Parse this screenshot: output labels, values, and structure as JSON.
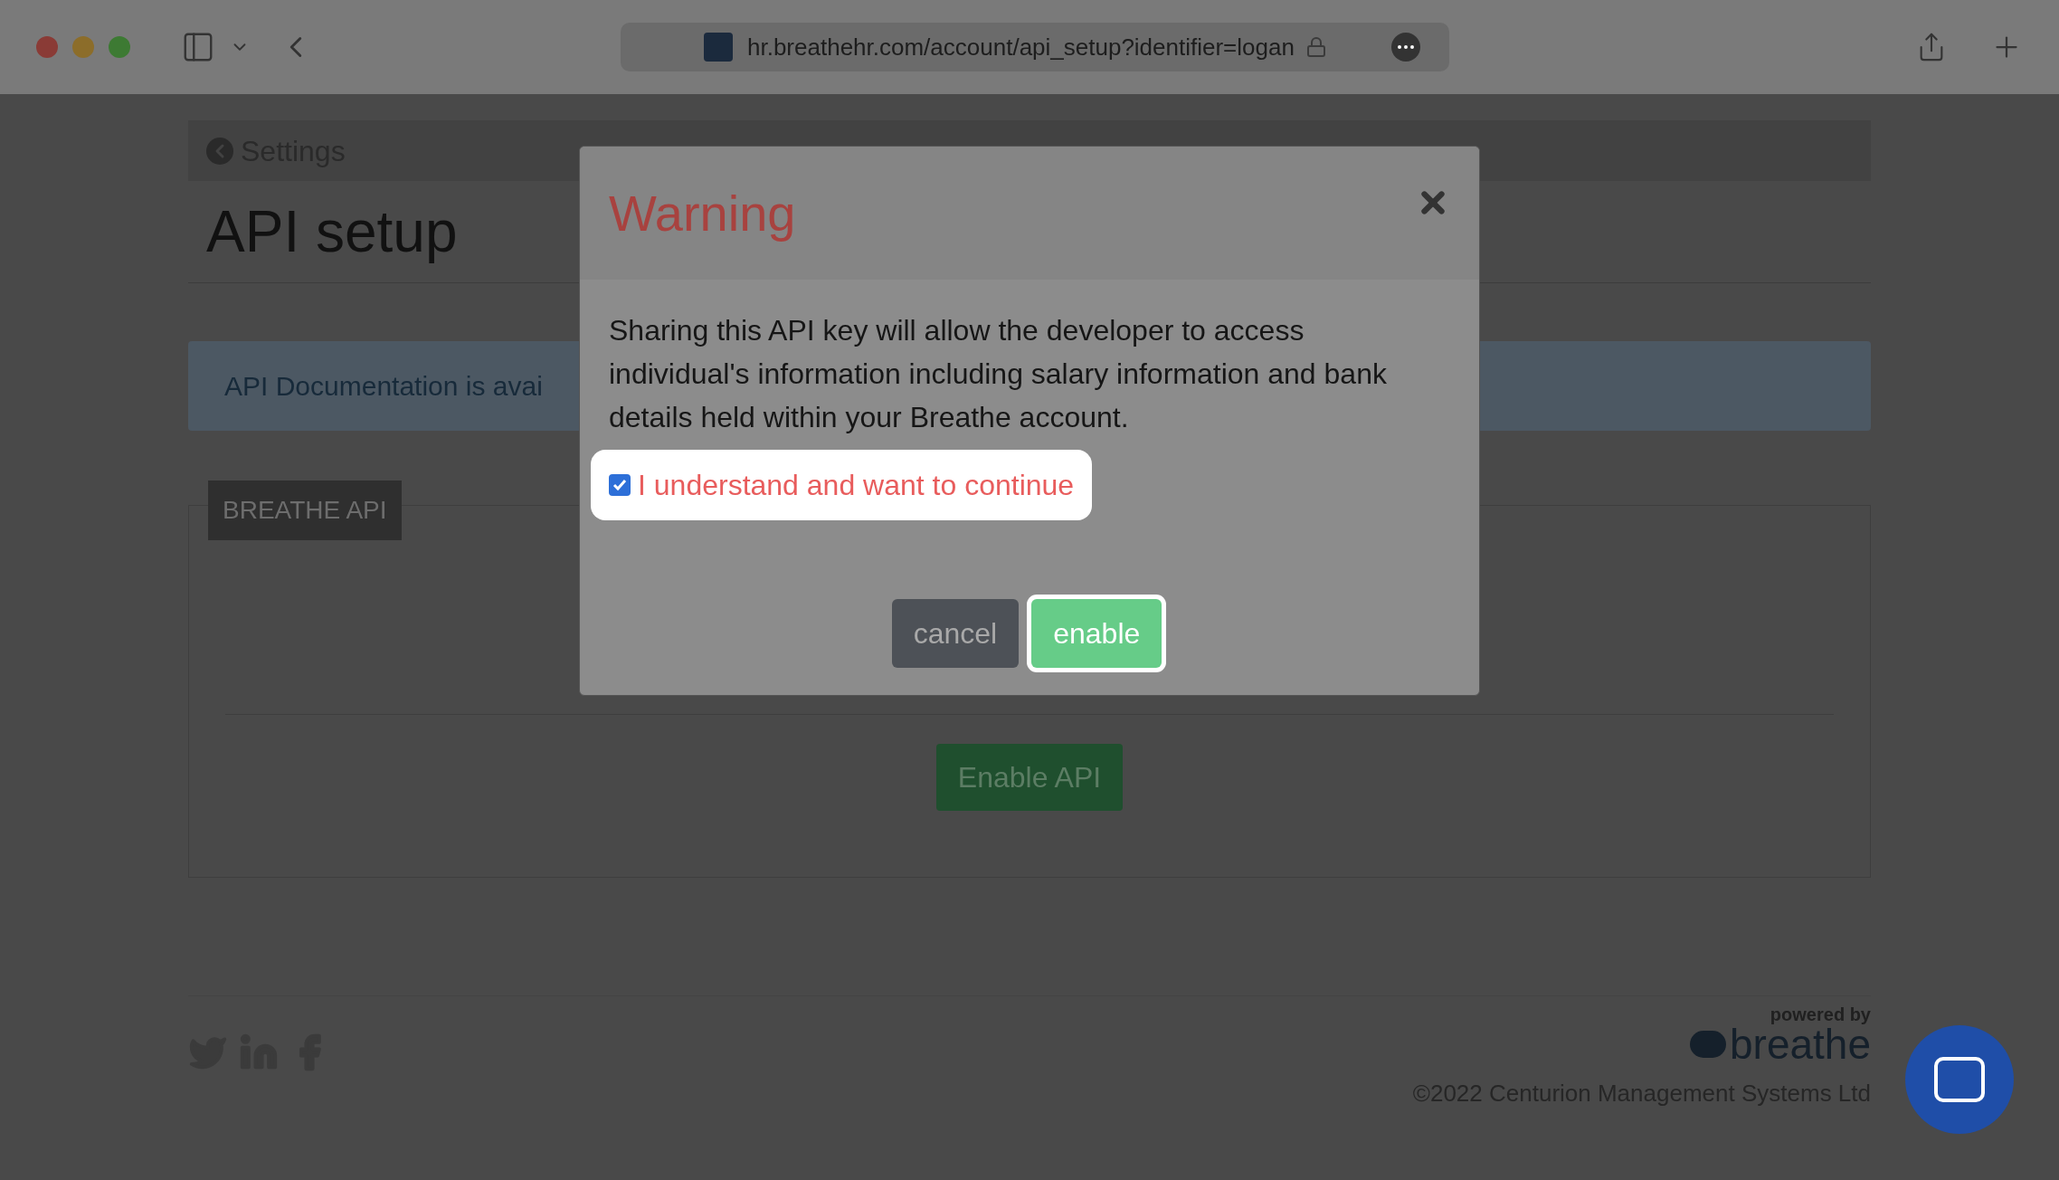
{
  "browser": {
    "url": "hr.breathehr.com/account/api_setup?identifier=logan"
  },
  "page": {
    "back_link": "Settings",
    "title": "API setup",
    "alert": "API Documentation is avai",
    "panel": {
      "legend": "BREATHE API",
      "button": "Enable API"
    }
  },
  "footer": {
    "powered_by": "powered by",
    "brand": "breathe",
    "copyright": "©2022 Centurion Management Systems Ltd"
  },
  "modal": {
    "title": "Warning",
    "body": "Sharing this API key will allow the developer to access individual's information including salary information and bank details held within your Breathe account.",
    "confirm": {
      "label": "I understand and want to continue",
      "checked": true
    },
    "buttons": [
      {
        "label": "cancel",
        "kind": "secondary",
        "focused": false
      },
      {
        "label": "enable",
        "kind": "primary",
        "focused": true
      }
    ]
  }
}
